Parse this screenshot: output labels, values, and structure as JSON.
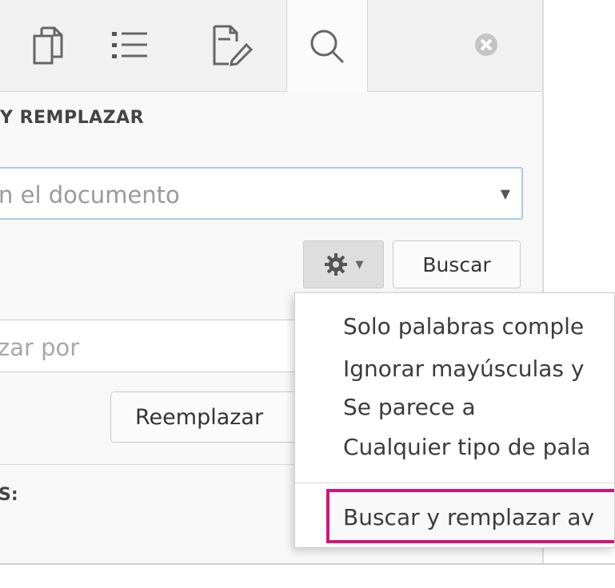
{
  "tabs": [
    {
      "icon": "document-icon"
    },
    {
      "icon": "list-icon"
    },
    {
      "icon": "edit-document-icon"
    },
    {
      "icon": "search-icon",
      "active": true
    }
  ],
  "panel": {
    "title": "Y REMPLAZAR",
    "search_placeholder": "n el documento",
    "find_label": "Buscar",
    "replace_placeholder": "zar por",
    "replace_label": "Reemplazar",
    "results_label": "S:"
  },
  "options_menu": {
    "items": [
      "Solo palabras comple",
      "Ignorar mayúsculas y",
      "Se parece a",
      "Cualquier tipo de pala"
    ],
    "advanced_label": "Buscar y remplazar av"
  },
  "colors": {
    "highlight_border": "#d2157a",
    "search_border": "#a9cbe8"
  }
}
